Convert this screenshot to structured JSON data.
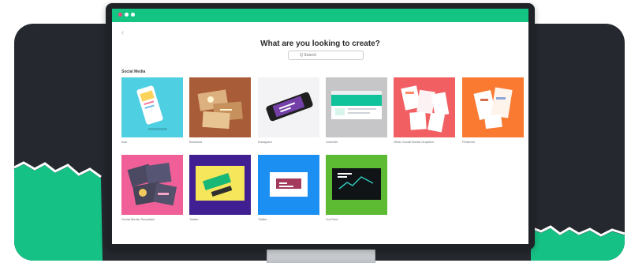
{
  "app": {
    "title": "What are you looking to create?",
    "search_placeholder": "Q Search",
    "section_label": "Social Media",
    "accent": "#13c483"
  },
  "window": {
    "controls": [
      "red-dot",
      "white-dot",
      "white-dot"
    ]
  },
  "templates": [
    {
      "name": "Ads",
      "color": "#4fd0e2"
    },
    {
      "name": "Business",
      "color": "#a95c38"
    },
    {
      "name": "Instagram",
      "color": "#f3f3f5"
    },
    {
      "name": "LinkedIn",
      "color": "#c6c6c8"
    },
    {
      "name": "Other Social Media Graphics",
      "color": "#f15f62"
    },
    {
      "name": "Pinterest",
      "color": "#fa7a32"
    },
    {
      "name": "Social Media Templates",
      "color": "#f05f97"
    },
    {
      "name": "Twitter",
      "color": "#3f1f92"
    },
    {
      "name": "Twitter",
      "color": "#1c8ff2"
    },
    {
      "name": "YouTube",
      "color": "#5cbb32"
    }
  ]
}
